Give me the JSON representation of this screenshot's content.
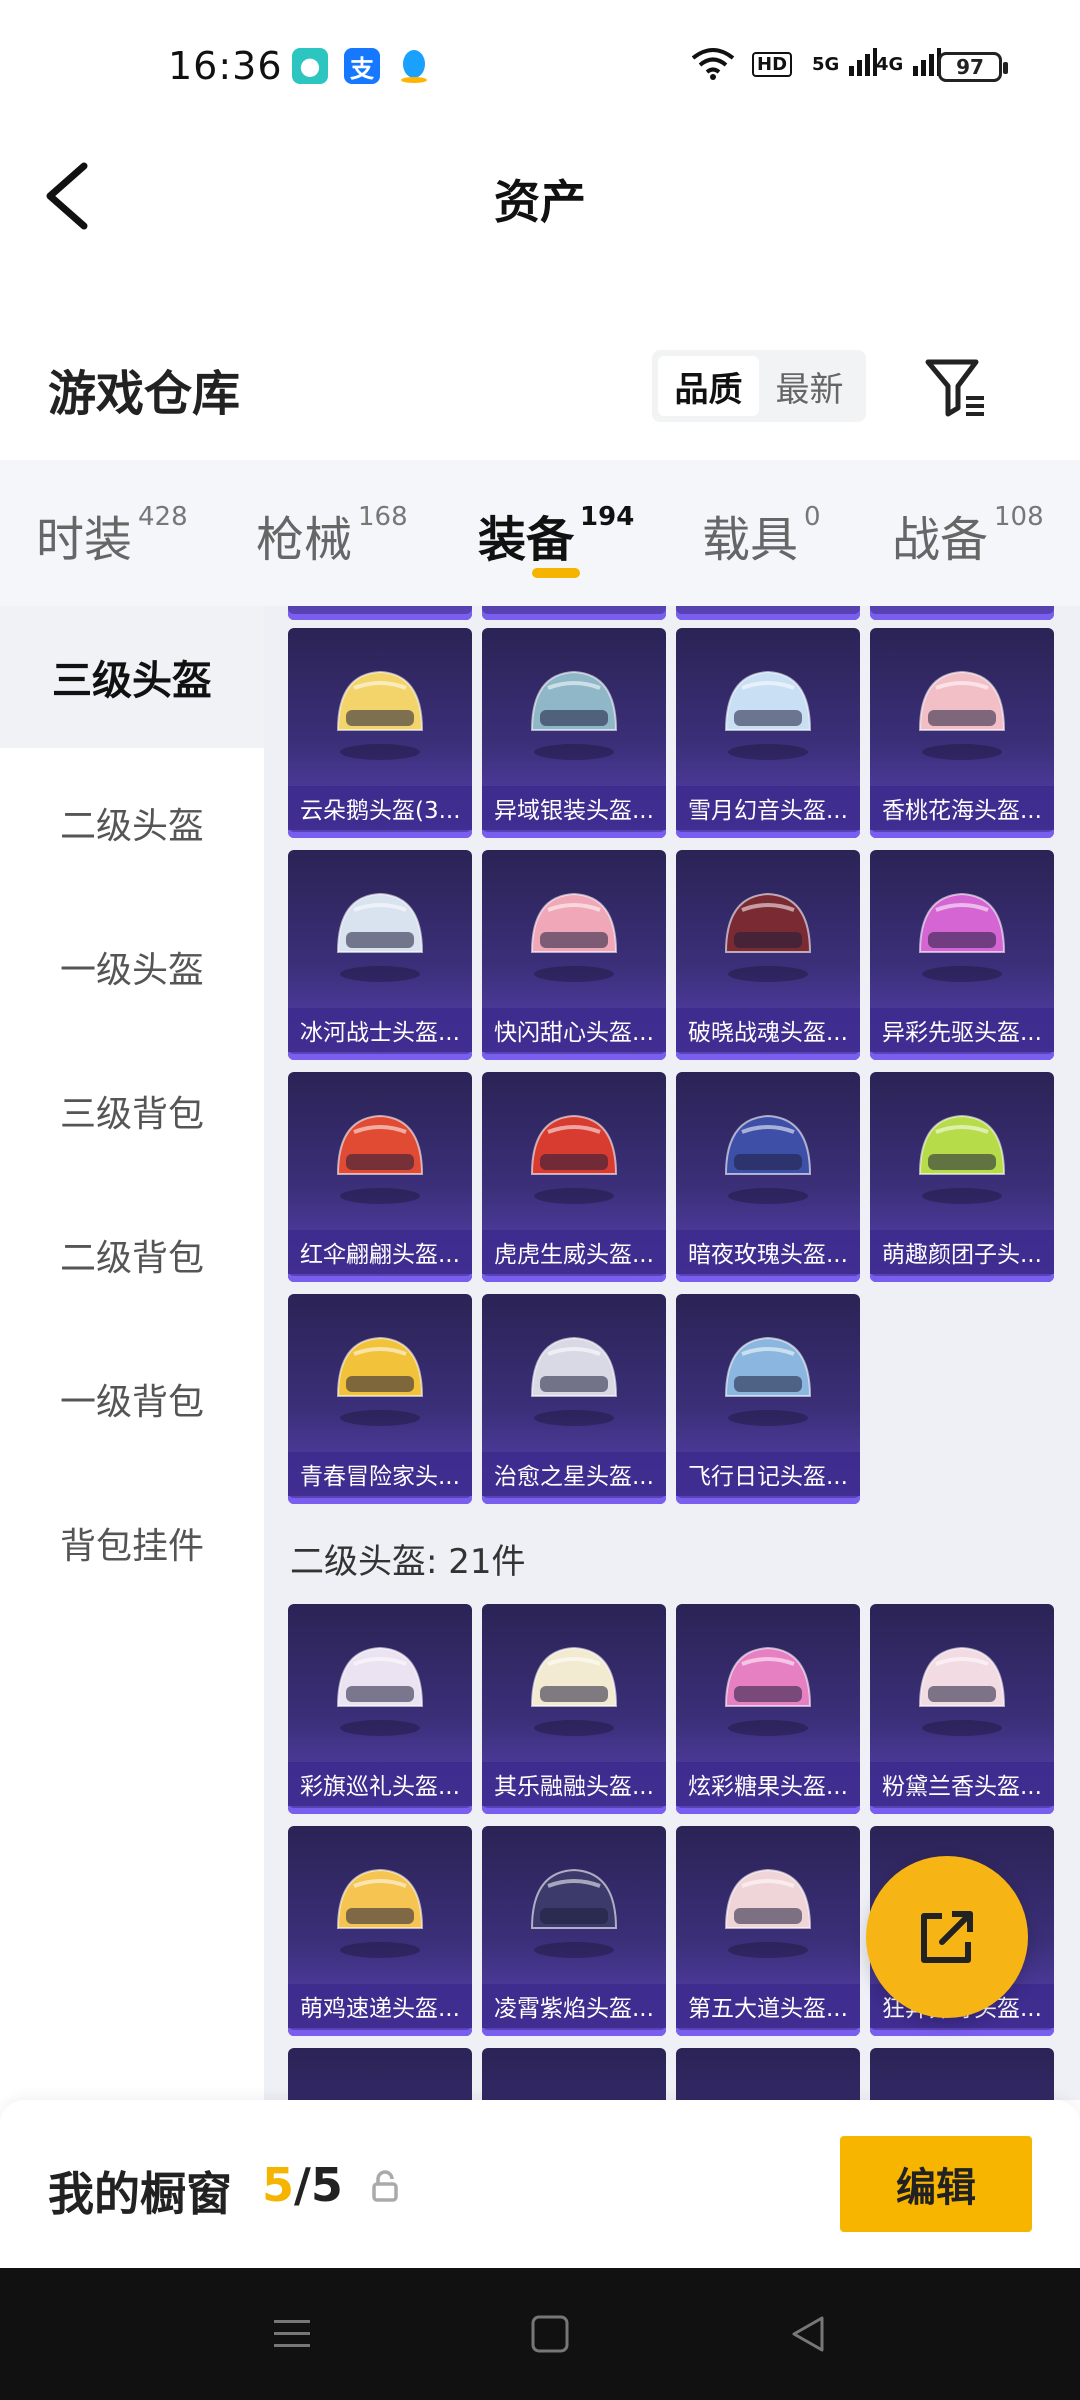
{
  "status_bar": {
    "time": "16:36",
    "battery": "97",
    "signal1": "5G",
    "signal2": "4G"
  },
  "nav": {
    "title": "资产"
  },
  "warehouse": {
    "title": "游戏仓库",
    "sort_options": [
      "品质",
      "最新"
    ],
    "sort_selected": "品质"
  },
  "tabs": [
    {
      "label": "时装",
      "count": "428"
    },
    {
      "label": "枪械",
      "count": "168"
    },
    {
      "label": "装备",
      "count": "194"
    },
    {
      "label": "载具",
      "count": "0"
    },
    {
      "label": "战备",
      "count": "108"
    }
  ],
  "active_tab": "装备",
  "sidebar": [
    {
      "label": "三级头盔"
    },
    {
      "label": "二级头盔"
    },
    {
      "label": "一级头盔"
    },
    {
      "label": "三级背包"
    },
    {
      "label": "二级背包"
    },
    {
      "label": "一级背包"
    },
    {
      "label": "背包挂件"
    }
  ],
  "level3_items": [
    {
      "name": "云朵鹅头盔(3...",
      "color": "#f2d46b"
    },
    {
      "name": "异域银装头盔...",
      "color": "#8fb7c7"
    },
    {
      "name": "雪月幻音头盔...",
      "color": "#c9dff4"
    },
    {
      "name": "香桃花海头盔...",
      "color": "#f3bfc7"
    },
    {
      "name": "冰河战士头盔...",
      "color": "#d9e2ef"
    },
    {
      "name": "快闪甜心头盔...",
      "color": "#f0a7b8"
    },
    {
      "name": "破晓战魂头盔...",
      "color": "#7a2a33"
    },
    {
      "name": "异彩先驱头盔...",
      "color": "#d565d3"
    },
    {
      "name": "红伞翩翩头盔...",
      "color": "#e24b33"
    },
    {
      "name": "虎虎生威头盔...",
      "color": "#d83b2f"
    },
    {
      "name": "暗夜玫瑰头盔...",
      "color": "#3e4fa8"
    },
    {
      "name": "萌趣颜团子头...",
      "color": "#b7dc4a"
    },
    {
      "name": "青春冒险家头...",
      "color": "#f2c23a"
    },
    {
      "name": "治愈之星头盔...",
      "color": "#d9d9e6"
    },
    {
      "name": "飞行日记头盔...",
      "color": "#8bb6df"
    }
  ],
  "level2_section": {
    "title": "二级头盔: 21件"
  },
  "level2_items": [
    {
      "name": "彩旗巡礼头盔...",
      "color": "#ebe3f2"
    },
    {
      "name": "其乐融融头盔...",
      "color": "#f3ead2"
    },
    {
      "name": "炫彩糖果头盔...",
      "color": "#e77fc3"
    },
    {
      "name": "粉黛兰香头盔...",
      "color": "#f2dbe2"
    },
    {
      "name": "萌鸡速递头盔...",
      "color": "#f6c450"
    },
    {
      "name": "凌霄紫焰头盔...",
      "color": "#3c3a6b"
    },
    {
      "name": "第五大道头盔...",
      "color": "#f0d5d8"
    },
    {
      "name": "狂奔莽野头盔...",
      "color": "#c2c6d4"
    }
  ],
  "showcase": {
    "label": "我的橱窗",
    "current": "5",
    "total": "/5",
    "edit_label": "编辑"
  }
}
